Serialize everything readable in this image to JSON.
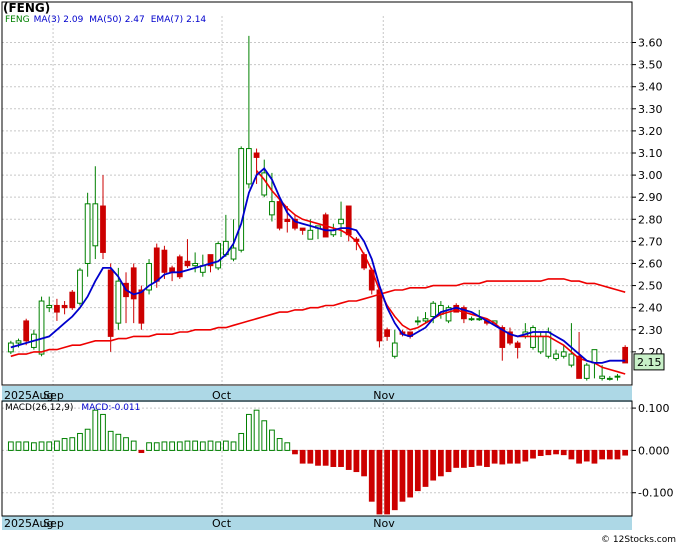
{
  "title": "(FENG)",
  "watermark": "© 12Stocks.com",
  "colors": {
    "up": "#008000",
    "down": "#cc0000",
    "ma_fast": "#0000cc",
    "ema": "#ee0000",
    "axis_band": "#add8e6",
    "price_tag": "#c8f0c8"
  },
  "price_legend": {
    "ticker": "FENG",
    "ma3": "MA(3)",
    "ma3_value": "2.09",
    "ma50": "MA(50)",
    "ma50_value": "2.47",
    "ema7": "EMA(7)",
    "ema7_value": "2.14"
  },
  "macd_legend": {
    "label": "MACD(26,12,9)",
    "value": "MACD:-0.011"
  },
  "last_price": "2.15",
  "price_ticks": [
    "3.60",
    "3.50",
    "3.40",
    "3.30",
    "3.20",
    "3.10",
    "3.00",
    "2.90",
    "2.80",
    "2.70",
    "2.60",
    "2.50",
    "2.40",
    "2.30",
    "2.20"
  ],
  "macd_ticks": [
    "0.100",
    "0.000",
    "-0.100"
  ],
  "month_labels": [
    "2025Aug",
    "Sep",
    "Oct",
    "Nov"
  ],
  "chart_data": [
    {
      "type": "candlestick",
      "title": "(FENG)",
      "ylim": [
        2.05,
        3.72
      ],
      "series": [
        {
          "name": "FENG",
          "ohlc": [
            [
              2.2,
              2.25,
              2.19,
              2.24
            ],
            [
              2.24,
              2.26,
              2.22,
              2.25
            ],
            [
              2.34,
              2.35,
              2.23,
              2.25
            ],
            [
              2.22,
              2.3,
              2.21,
              2.28
            ],
            [
              2.19,
              2.45,
              2.18,
              2.43
            ],
            [
              2.4,
              2.45,
              2.38,
              2.41
            ],
            [
              2.41,
              2.44,
              2.34,
              2.38
            ],
            [
              2.41,
              2.43,
              2.37,
              2.4
            ],
            [
              2.47,
              2.48,
              2.39,
              2.4
            ],
            [
              2.42,
              2.58,
              2.41,
              2.57
            ],
            [
              2.6,
              2.92,
              2.54,
              2.87
            ],
            [
              2.68,
              3.04,
              2.62,
              2.87
            ],
            [
              2.86,
              3.0,
              2.62,
              2.65
            ],
            [
              2.57,
              2.6,
              2.2,
              2.27
            ],
            [
              2.33,
              2.58,
              2.3,
              2.52
            ],
            [
              2.51,
              2.56,
              2.33,
              2.45
            ],
            [
              2.58,
              2.6,
              2.33,
              2.44
            ],
            [
              2.48,
              2.5,
              2.3,
              2.33
            ],
            [
              2.48,
              2.62,
              2.46,
              2.6
            ],
            [
              2.67,
              2.69,
              2.49,
              2.52
            ],
            [
              2.66,
              2.68,
              2.53,
              2.56
            ],
            [
              2.58,
              2.59,
              2.52,
              2.56
            ],
            [
              2.63,
              2.64,
              2.53,
              2.54
            ],
            [
              2.61,
              2.71,
              2.58,
              2.59
            ],
            [
              2.59,
              2.65,
              2.56,
              2.6
            ],
            [
              2.56,
              2.64,
              2.54,
              2.59
            ],
            [
              2.64,
              2.64,
              2.56,
              2.59
            ],
            [
              2.58,
              2.7,
              2.57,
              2.69
            ],
            [
              2.64,
              2.82,
              2.63,
              2.7
            ],
            [
              2.62,
              2.8,
              2.61,
              2.67
            ],
            [
              2.66,
              3.13,
              2.65,
              3.12
            ],
            [
              2.96,
              3.63,
              2.94,
              3.12
            ],
            [
              3.1,
              3.12,
              2.96,
              3.08
            ],
            [
              2.91,
              3.07,
              2.9,
              3.01
            ],
            [
              2.82,
              3.01,
              2.79,
              2.88
            ],
            [
              2.88,
              2.89,
              2.75,
              2.76
            ],
            [
              2.8,
              2.86,
              2.74,
              2.79
            ],
            [
              2.8,
              2.82,
              2.75,
              2.76
            ],
            [
              2.76,
              2.76,
              2.73,
              2.75
            ],
            [
              2.71,
              2.8,
              2.71,
              2.75
            ],
            [
              2.76,
              2.77,
              2.71,
              2.77
            ],
            [
              2.82,
              2.83,
              2.72,
              2.72
            ],
            [
              2.73,
              2.78,
              2.72,
              2.75
            ],
            [
              2.78,
              2.88,
              2.72,
              2.8
            ],
            [
              2.86,
              2.86,
              2.7,
              2.73
            ],
            [
              2.71,
              2.72,
              2.66,
              2.7
            ],
            [
              2.64,
              2.65,
              2.57,
              2.58
            ],
            [
              2.57,
              2.58,
              2.46,
              2.48
            ],
            [
              2.48,
              2.48,
              2.22,
              2.25
            ],
            [
              2.3,
              2.31,
              2.25,
              2.27
            ],
            [
              2.18,
              2.3,
              2.17,
              2.24
            ],
            [
              2.29,
              2.3,
              2.27,
              2.28
            ],
            [
              2.29,
              2.29,
              2.26,
              2.27
            ],
            [
              2.34,
              2.36,
              2.32,
              2.34
            ],
            [
              2.34,
              2.38,
              2.33,
              2.35
            ],
            [
              2.36,
              2.43,
              2.33,
              2.42
            ],
            [
              2.37,
              2.43,
              2.35,
              2.41
            ],
            [
              2.34,
              2.41,
              2.33,
              2.4
            ],
            [
              2.41,
              2.42,
              2.38,
              2.38
            ],
            [
              2.4,
              2.41,
              2.33,
              2.35
            ],
            [
              2.35,
              2.36,
              2.34,
              2.35
            ],
            [
              2.35,
              2.39,
              2.34,
              2.35
            ],
            [
              2.34,
              2.35,
              2.32,
              2.33
            ],
            [
              2.33,
              2.33,
              2.34,
              2.34
            ],
            [
              2.31,
              2.32,
              2.16,
              2.22
            ],
            [
              2.29,
              2.31,
              2.23,
              2.24
            ],
            [
              2.24,
              2.25,
              2.17,
              2.22
            ],
            [
              2.27,
              2.33,
              2.26,
              2.29
            ],
            [
              2.22,
              2.32,
              2.21,
              2.31
            ],
            [
              2.2,
              2.29,
              2.19,
              2.27
            ],
            [
              2.18,
              2.31,
              2.17,
              2.29
            ],
            [
              2.17,
              2.21,
              2.16,
              2.19
            ],
            [
              2.18,
              2.23,
              2.17,
              2.2
            ],
            [
              2.14,
              2.33,
              2.13,
              2.19
            ],
            [
              2.18,
              2.29,
              2.08,
              2.08
            ],
            [
              2.08,
              2.15,
              2.07,
              2.14
            ],
            [
              2.15,
              2.21,
              2.08,
              2.21
            ],
            [
              2.08,
              2.14,
              2.07,
              2.09
            ],
            [
              2.08,
              2.09,
              2.07,
              2.08
            ],
            [
              2.09,
              2.1,
              2.07,
              2.09
            ],
            [
              2.22,
              2.23,
              2.15,
              2.15
            ]
          ]
        },
        {
          "name": "MA(3)",
          "values": [
            2.22,
            2.23,
            2.24,
            2.25,
            2.26,
            2.27,
            2.3,
            2.33,
            2.36,
            2.4,
            2.45,
            2.52,
            2.58,
            2.58,
            2.54,
            2.48,
            2.46,
            2.47,
            2.5,
            2.52,
            2.55,
            2.56,
            2.56,
            2.57,
            2.58,
            2.59,
            2.6,
            2.61,
            2.64,
            2.69,
            2.78,
            2.92,
            3.0,
            3.03,
            2.98,
            2.9,
            2.83,
            2.79,
            2.78,
            2.77,
            2.76,
            2.75,
            2.75,
            2.76,
            2.76,
            2.75,
            2.7,
            2.62,
            2.5,
            2.4,
            2.33,
            2.28,
            2.27,
            2.29,
            2.31,
            2.35,
            2.38,
            2.39,
            2.4,
            2.39,
            2.38,
            2.36,
            2.34,
            2.32,
            2.3,
            2.28,
            2.27,
            2.28,
            2.29,
            2.29,
            2.29,
            2.27,
            2.25,
            2.22,
            2.19,
            2.16,
            2.15,
            2.15,
            2.16,
            2.16,
            2.16
          ]
        },
        {
          "name": "EMA(7)",
          "values": [
            null,
            null,
            null,
            null,
            null,
            null,
            null,
            null,
            null,
            null,
            null,
            null,
            null,
            null,
            null,
            null,
            null,
            null,
            null,
            null,
            null,
            null,
            null,
            null,
            null,
            null,
            null,
            null,
            null,
            null,
            null,
            null,
            3.02,
            2.98,
            2.93,
            2.89,
            2.85,
            2.82,
            2.8,
            2.79,
            2.78,
            2.77,
            2.76,
            2.75,
            2.73,
            2.7,
            2.64,
            2.57,
            2.48,
            2.41,
            2.36,
            2.32,
            2.3,
            2.31,
            2.33,
            2.35,
            2.37,
            2.38,
            2.39,
            2.38,
            2.37,
            2.36,
            2.35,
            2.33,
            2.3,
            2.28,
            2.27,
            2.27,
            2.27,
            2.27,
            2.27,
            2.25,
            2.23,
            2.2,
            2.17,
            2.16,
            2.15,
            2.13,
            2.12,
            2.11,
            2.1
          ]
        },
        {
          "name": "MA(50)",
          "values": [
            2.18,
            2.19,
            2.19,
            2.2,
            2.2,
            2.21,
            2.21,
            2.22,
            2.23,
            2.23,
            2.24,
            2.25,
            2.25,
            2.25,
            2.26,
            2.26,
            2.27,
            2.27,
            2.27,
            2.28,
            2.28,
            2.28,
            2.29,
            2.29,
            2.3,
            2.3,
            2.3,
            2.31,
            2.31,
            2.32,
            2.33,
            2.34,
            2.35,
            2.36,
            2.37,
            2.38,
            2.38,
            2.39,
            2.39,
            2.4,
            2.4,
            2.41,
            2.41,
            2.42,
            2.43,
            2.43,
            2.44,
            2.45,
            2.46,
            2.47,
            2.48,
            2.48,
            2.49,
            2.49,
            2.49,
            2.5,
            2.5,
            2.5,
            2.5,
            2.51,
            2.51,
            2.51,
            2.52,
            2.52,
            2.52,
            2.52,
            2.52,
            2.52,
            2.52,
            2.52,
            2.53,
            2.53,
            2.53,
            2.52,
            2.52,
            2.51,
            2.51,
            2.5,
            2.49,
            2.48,
            2.47
          ]
        }
      ]
    },
    {
      "type": "bar",
      "title": "MACD(26,12,9)",
      "ylim": [
        -0.155,
        0.112
      ],
      "series": [
        {
          "name": "MACD",
          "values": [
            0.02,
            0.02,
            0.02,
            0.018,
            0.02,
            0.02,
            0.022,
            0.028,
            0.03,
            0.04,
            0.05,
            0.095,
            0.085,
            0.045,
            0.038,
            0.03,
            0.022,
            -0.005,
            0.018,
            0.018,
            0.02,
            0.02,
            0.02,
            0.022,
            0.022,
            0.02,
            0.022,
            0.02,
            0.022,
            0.02,
            0.04,
            0.085,
            0.095,
            0.07,
            0.048,
            0.028,
            0.018,
            -0.008,
            -0.03,
            -0.03,
            -0.035,
            -0.035,
            -0.038,
            -0.038,
            -0.045,
            -0.05,
            -0.06,
            -0.12,
            -0.15,
            -0.15,
            -0.14,
            -0.12,
            -0.11,
            -0.095,
            -0.085,
            -0.07,
            -0.06,
            -0.05,
            -0.04,
            -0.04,
            -0.038,
            -0.035,
            -0.038,
            -0.03,
            -0.032,
            -0.03,
            -0.03,
            -0.025,
            -0.018,
            -0.012,
            -0.01,
            -0.008,
            -0.01,
            -0.02,
            -0.03,
            -0.025,
            -0.03,
            -0.02,
            -0.02,
            -0.02,
            -0.011
          ]
        }
      ]
    }
  ]
}
